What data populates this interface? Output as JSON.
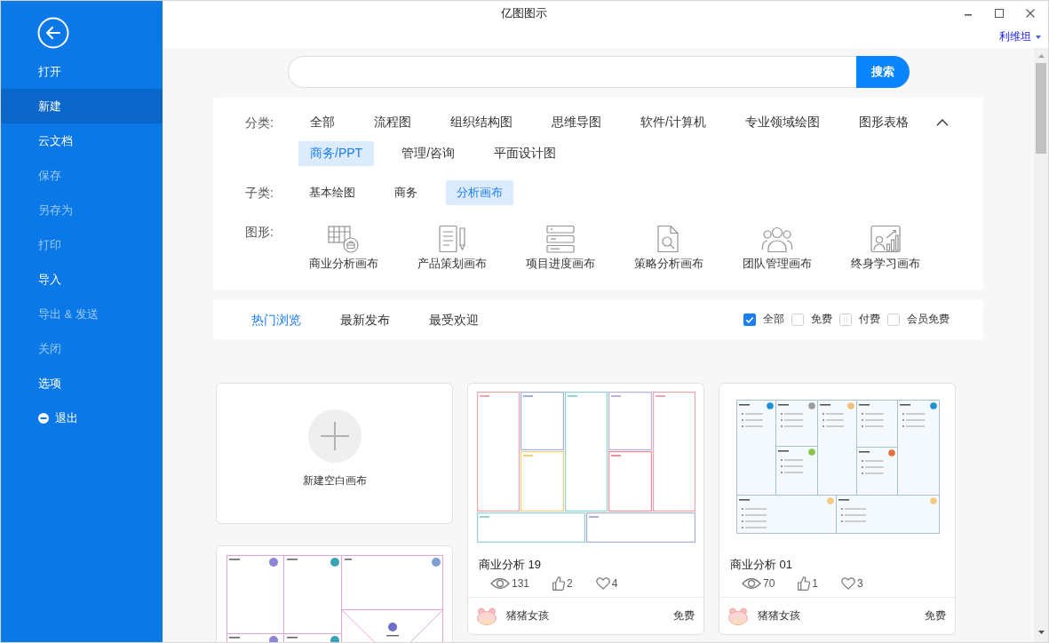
{
  "window": {
    "title": "亿图图示",
    "user": "利维坦"
  },
  "sidebar": {
    "items": [
      {
        "label": "打开",
        "kind": "text",
        "selected": false,
        "disabled": false
      },
      {
        "label": "新建",
        "kind": "text",
        "selected": true,
        "disabled": false
      },
      {
        "label": "云文档",
        "kind": "text",
        "selected": false,
        "disabled": false
      },
      {
        "label": "保存",
        "kind": "text",
        "selected": false,
        "disabled": true
      },
      {
        "label": "另存为",
        "kind": "text",
        "selected": false,
        "disabled": true
      },
      {
        "label": "打印",
        "kind": "text",
        "selected": false,
        "disabled": true
      },
      {
        "label": "导入",
        "kind": "text",
        "selected": false,
        "disabled": false
      },
      {
        "label": "导出 & 发送",
        "kind": "text",
        "selected": false,
        "disabled": true
      },
      {
        "label": "关闭",
        "kind": "text",
        "selected": false,
        "disabled": true
      },
      {
        "label": "选项",
        "kind": "text",
        "selected": false,
        "disabled": false
      },
      {
        "label": "退出",
        "kind": "exit",
        "selected": false,
        "disabled": false
      }
    ]
  },
  "search": {
    "button": "搜索"
  },
  "filters": {
    "category": {
      "label": "分类:",
      "expanded": true,
      "items": [
        {
          "label": "全部",
          "selected": false
        },
        {
          "label": "流程图",
          "selected": false
        },
        {
          "label": "组织结构图",
          "selected": false
        },
        {
          "label": "思维导图",
          "selected": false
        },
        {
          "label": "软件/计算机",
          "selected": false
        },
        {
          "label": "专业领域绘图",
          "selected": false
        },
        {
          "label": "图形表格",
          "selected": false
        },
        {
          "label": "商务/PPT",
          "selected": true
        },
        {
          "label": "管理/咨询",
          "selected": false
        },
        {
          "label": "平面设计图",
          "selected": false
        }
      ]
    },
    "subcategory": {
      "label": "子类:",
      "items": [
        {
          "label": "基本绘图",
          "selected": false
        },
        {
          "label": "商务",
          "selected": false
        },
        {
          "label": "分析画布",
          "selected": true
        }
      ]
    },
    "shapes": {
      "label": "图形:",
      "items": [
        {
          "label": "商业分析画布",
          "kind": "table-briefcase"
        },
        {
          "label": "产品策划画布",
          "kind": "document-pencil"
        },
        {
          "label": "项目进度画布",
          "kind": "stacked-rows"
        },
        {
          "label": "策略分析画布",
          "kind": "document-magnifier"
        },
        {
          "label": "团队管理画布",
          "kind": "people-group"
        },
        {
          "label": "终身学习画布",
          "kind": "person-chart"
        }
      ]
    }
  },
  "sort_tabs": [
    {
      "label": "热门浏览",
      "selected": true
    },
    {
      "label": "最新发布",
      "selected": false
    },
    {
      "label": "最受欢迎",
      "selected": false
    }
  ],
  "price_filters": [
    {
      "label": "全部",
      "checked": true
    },
    {
      "label": "免费",
      "checked": false
    },
    {
      "label": "付费",
      "checked": false
    },
    {
      "label": "会员免费",
      "checked": false
    }
  ],
  "templates": [
    {
      "kind": "blank",
      "label": "新建空白画布"
    },
    {
      "kind": "template",
      "preview": {
        "kind": "colored-outline"
      },
      "title": "商业分析 19",
      "views": "131",
      "likes": "2",
      "favorites": "4",
      "author": "猪猪女孩",
      "price": "免费"
    },
    {
      "kind": "template",
      "preview": {
        "kind": "tinted"
      },
      "title": "商业分析 01",
      "views": "70",
      "likes": "1",
      "favorites": "3",
      "author": "猪猪女孩",
      "price": "免费"
    },
    {
      "kind": "template",
      "preview": {
        "kind": "lined"
      }
    }
  ]
}
